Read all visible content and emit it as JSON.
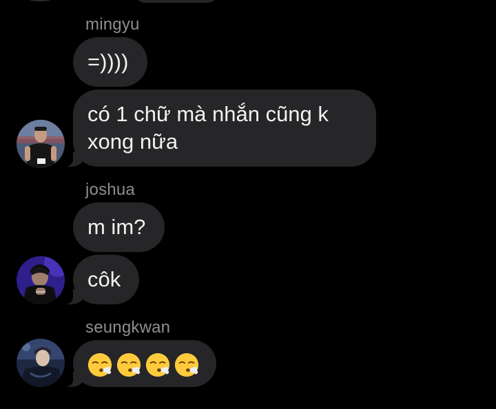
{
  "chat": {
    "groups": [
      {
        "sender": "mingyu",
        "avatar": "avatar-mingyu",
        "messages": [
          "=))))",
          "có 1 chữ mà nhắn cũng k",
          "xong nữa"
        ]
      },
      {
        "sender": "joshua",
        "avatar": "avatar-joshua",
        "messages": [
          "m im?",
          "côk"
        ]
      },
      {
        "sender": "seungkwan",
        "avatar": "avatar-seungkwan",
        "messages": [
          "😮‍💨😮‍💨😮‍💨😮‍💨"
        ]
      }
    ],
    "colors": {
      "background": "#000000",
      "bubble": "#262628",
      "text": "#f2f2f2",
      "sender_name": "#8e8e93"
    },
    "icons": [
      "face-exhaling-emoji"
    ]
  }
}
